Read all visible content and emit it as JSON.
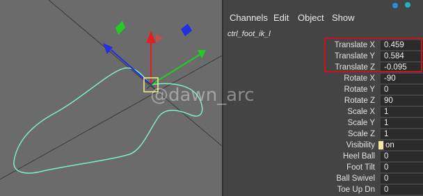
{
  "menu": {
    "channels": "Channels",
    "edit": "Edit",
    "object": "Object",
    "show": "Show"
  },
  "node_name": "ctrl_foot_ik_l",
  "watermark": "@dawn_arc",
  "channels": [
    {
      "label": "Translate X",
      "value": "0.459"
    },
    {
      "label": "Translate Y",
      "value": "0.584"
    },
    {
      "label": "Translate Z",
      "value": "-0.095"
    },
    {
      "label": "Rotate X",
      "value": "-90"
    },
    {
      "label": "Rotate Y",
      "value": "0"
    },
    {
      "label": "Rotate Z",
      "value": "90"
    },
    {
      "label": "Scale X",
      "value": "1"
    },
    {
      "label": "Scale Y",
      "value": "1"
    },
    {
      "label": "Scale Z",
      "value": "1"
    },
    {
      "label": "Visibility",
      "value": "on"
    },
    {
      "label": "Heel Ball",
      "value": "0"
    },
    {
      "label": "Foot Tilt",
      "value": "0"
    },
    {
      "label": "Ball Swivel",
      "value": "0"
    },
    {
      "label": "Toe Up Dn",
      "value": "0"
    }
  ],
  "colors": {
    "viewport_bg": "#6b6b6b",
    "panel_bg": "#444444",
    "field_bg": "#2b2b2b",
    "highlight_box": "#c81418",
    "curve": "#7cf0c0",
    "axis_x": "#e02020",
    "axis_y": "#22cc22",
    "axis_z": "#2030e0"
  },
  "icons": [
    "x-axis-handle-icon",
    "y-axis-handle-icon",
    "z-axis-handle-icon",
    "pivot-box-icon",
    "top-right-icons"
  ]
}
